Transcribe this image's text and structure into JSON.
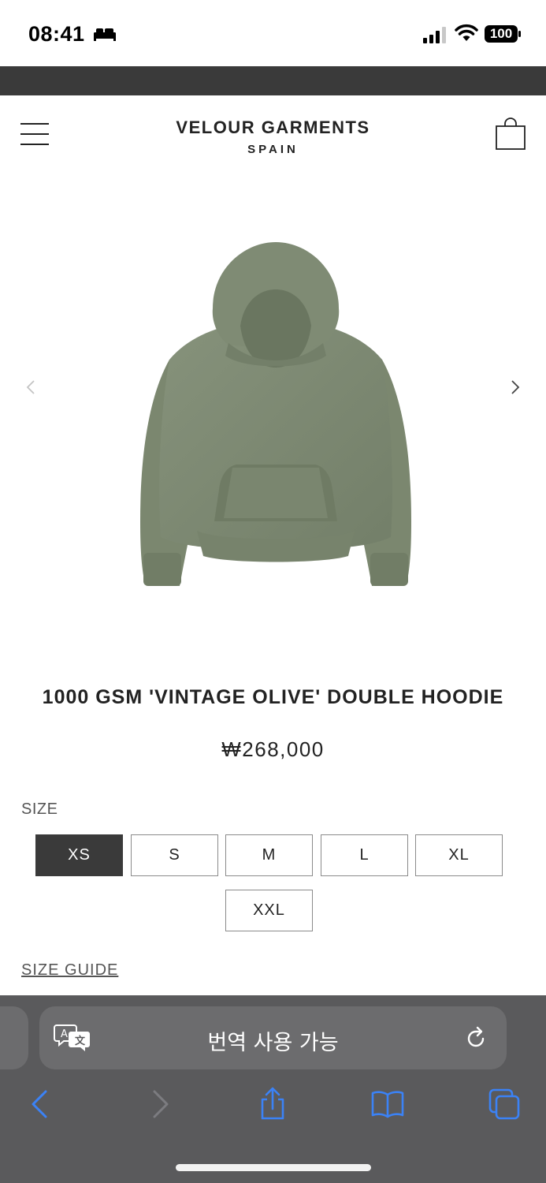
{
  "status_bar": {
    "time": "08:41",
    "battery": "100"
  },
  "header": {
    "brand_name": "VELOUR GARMENTS",
    "brand_sub": "SPAIN"
  },
  "gallery": {
    "image": "olive-hoodie-image",
    "hoodie_color": "#7d8a72"
  },
  "product": {
    "title": "1000 GSM 'VINTAGE OLIVE' DOUBLE HOODIE",
    "price": "₩268,000",
    "size_label": "SIZE",
    "sizes": [
      "XS",
      "S",
      "M",
      "L",
      "XL",
      "XXL"
    ],
    "selected_size": "XS",
    "size_guide": "SIZE GUIDE"
  },
  "safari": {
    "address_text": "번역 사용 가능",
    "toolbar": [
      "back-icon",
      "forward-icon",
      "share-icon",
      "bookmarks-icon",
      "tabs-icon"
    ],
    "accent_color": "#3b82f6"
  }
}
